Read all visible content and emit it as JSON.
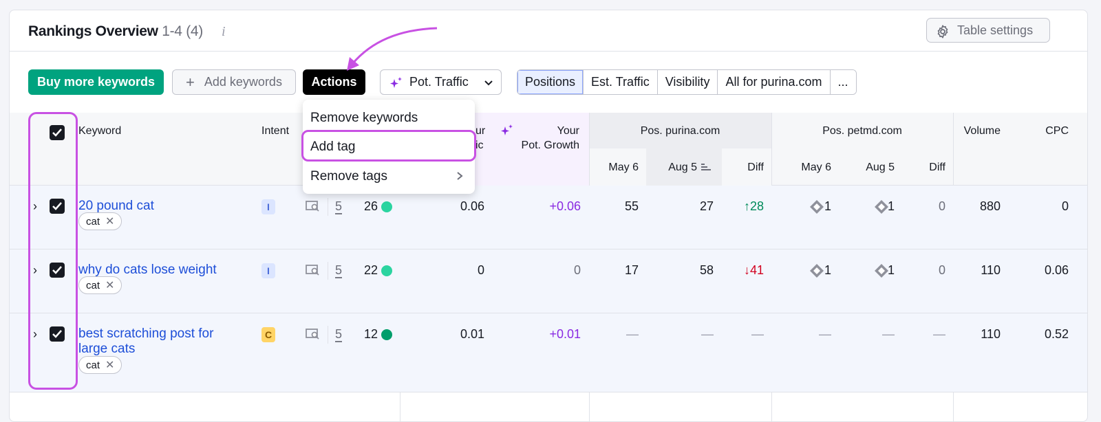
{
  "header": {
    "title": "Rankings Overview",
    "count": "1-4 (4)",
    "info_icon": "info-icon",
    "table_settings_label": "Table settings"
  },
  "toolbar": {
    "buy_label": "Buy more keywords",
    "add_label": "Add keywords",
    "actions_label": "Actions",
    "pot_traffic_label": "Pot. Traffic",
    "segments": [
      "Positions",
      "Est. Traffic",
      "Visibility",
      "All for purina.com",
      "..."
    ],
    "active_segment": "Positions"
  },
  "menu": {
    "items": [
      "Remove keywords",
      "Add tag",
      "Remove tags"
    ]
  },
  "columns": {
    "keyword": "Keyword",
    "intent": "Intent",
    "pot_traffic_partial": "ur",
    "pot_traffic_partial2": "ic",
    "pot_growth": [
      "Your",
      "Pot. Growth"
    ],
    "pos_purina": "Pos. purina.com",
    "pos_petmd": "Pos. petmd.com",
    "sub_may": "May 6",
    "sub_aug": "Aug 5",
    "sub_diff": "Diff",
    "volume": "Volume",
    "cpc": "CPC"
  },
  "rows": [
    {
      "keyword": "20 pound cat",
      "tag": "cat",
      "intent": "I",
      "serp": "5",
      "kd": "26",
      "kd_color": "#2bd4a0",
      "pot_traffic": "0.06",
      "pot_growth": "+0.06",
      "p_may": "55",
      "p_aug": "27",
      "p_diff": "↑28",
      "m_may": "1",
      "m_aug": "1",
      "m_diff": "0",
      "volume": "880",
      "cpc": "0"
    },
    {
      "keyword": "why do cats lose weight",
      "tag": "cat",
      "intent": "I",
      "serp": "5",
      "kd": "22",
      "kd_color": "#2bd4a0",
      "pot_traffic": "0",
      "pot_growth": "0",
      "p_may": "17",
      "p_aug": "58",
      "p_diff": "↓41",
      "m_may": "1",
      "m_aug": "1",
      "m_diff": "0",
      "volume": "110",
      "cpc": "0.06"
    },
    {
      "keyword": "best scratching post for large cats",
      "tag": "cat",
      "intent": "C",
      "serp": "5",
      "kd": "12",
      "kd_color": "#009e6b",
      "pot_traffic": "0.01",
      "pot_growth": "+0.01",
      "p_may": "—",
      "p_aug": "—",
      "p_diff": "—",
      "m_may": "—",
      "m_aug": "—",
      "m_diff": "—",
      "volume": "110",
      "cpc": "0.52"
    }
  ],
  "colors": {
    "accent": "#00a37f",
    "highlight": "#c851e3",
    "link": "#1d4ed8"
  }
}
